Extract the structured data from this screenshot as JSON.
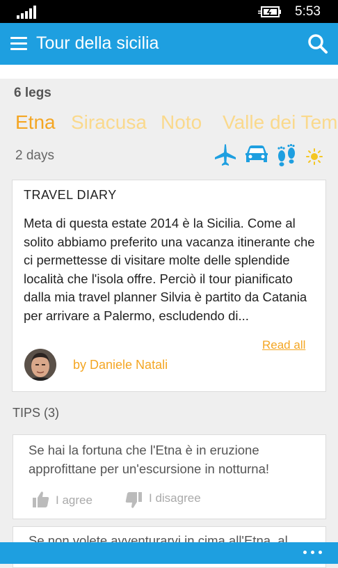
{
  "status": {
    "time": "5:53"
  },
  "appbar": {
    "title": "Tour della sicilia"
  },
  "legs": {
    "count_label": "6 legs"
  },
  "tabs": [
    "Etna",
    "Siracusa",
    "Noto",
    "Valle dei Templi"
  ],
  "leg": {
    "duration": "2 days"
  },
  "transport_icons": [
    "plane-icon",
    "car-icon",
    "footprints-icon",
    "sun-icon"
  ],
  "diary": {
    "title": "TRAVEL DIARY",
    "text": "Meta di questa estate 2014 è la Sicilia. Come al solito abbiamo preferito una vacanza itinerante che ci permettesse di visitare molte delle splendide località che l'isola offre. Perciò il tour pianificato dalla mia travel planner Silvia è partito da Catania per arrivare a Palermo, escludendo di...",
    "read_all": "Read all",
    "author": "by Daniele Natali"
  },
  "tips": {
    "header": "TIPS (3)",
    "items": [
      {
        "text": "Se hai la fortuna che l'Etna è in eruzione approfittane per un'escursione in notturna!",
        "agree": "I agree",
        "disagree": "I disagree"
      },
      {
        "text": "Se non volete avventurarvi in cima all'Etna, al"
      }
    ]
  },
  "colors": {
    "accent": "#1e9fe0",
    "orange": "#f4a623",
    "orange_faded": "#fad98c",
    "background": "#efefef"
  }
}
